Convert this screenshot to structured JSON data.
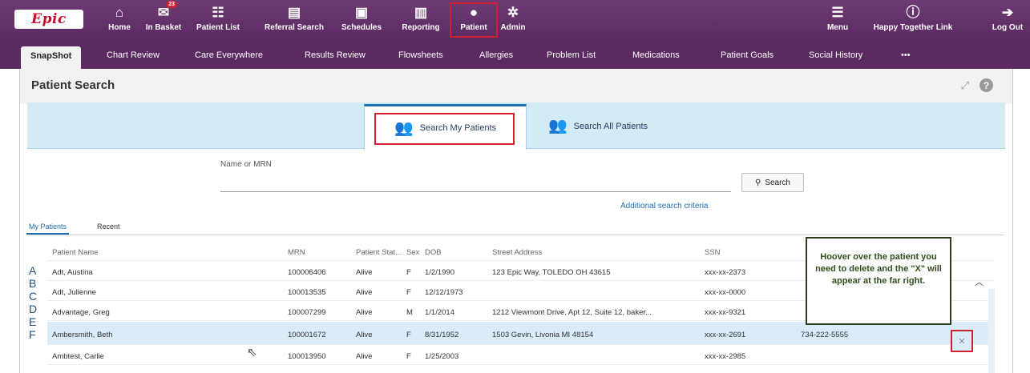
{
  "app": {
    "logo_text": "Epic",
    "brand_color": "#5b2a61",
    "highlight_color": "#d3202e"
  },
  "toolbar": {
    "buttons": [
      {
        "label": "Home",
        "icon": "home-icon"
      },
      {
        "label": "In Basket",
        "icon": "inbox-icon",
        "badge": "23"
      },
      {
        "label": "Patient List",
        "icon": "patient-list-icon"
      },
      {
        "label": "Referral Search",
        "icon": "referral-search-icon"
      },
      {
        "label": "Schedules",
        "icon": "calendar-icon"
      },
      {
        "label": "Reporting",
        "icon": "reporting-icon"
      },
      {
        "label": "Patient",
        "icon": "person-icon"
      },
      {
        "label": "Admin",
        "icon": "gear-icon"
      },
      {
        "label": "Menu",
        "icon": "menu-icon"
      },
      {
        "label": "Happy Together Link",
        "icon": "info-link-icon"
      },
      {
        "label": "Log Out",
        "icon": "logout-icon"
      }
    ]
  },
  "activity_tabs": [
    "SnapShot",
    "Chart Review",
    "Care Everywhere",
    "Results Review",
    "Flowsheets",
    "Allergies",
    "Problem List",
    "Medications",
    "Patient Goals",
    "Social History",
    "•••"
  ],
  "page": {
    "title": "Patient Search",
    "search_tabs": {
      "my_patients": "Search My Patients",
      "all_patients": "Search All Patients"
    },
    "search": {
      "label": "Name or MRN",
      "value": "",
      "button_label": "Search",
      "advanced_link": "Additional search criteria"
    },
    "list_tabs": {
      "my_patients": "My Patients",
      "recent": "Recent"
    },
    "alphabet": [
      "A",
      "B",
      "C",
      "D",
      "E",
      "F"
    ],
    "table": {
      "headers": {
        "name": "Patient Name",
        "mrn": "MRN",
        "status": "Patient Stat...",
        "sex": "Sex",
        "dob": "DOB",
        "address": "Street Address",
        "ssn": "SSN"
      },
      "rows": [
        {
          "name": "Adt, Austina",
          "mrn": "100006406",
          "status": "Alive",
          "sex": "F",
          "dob": "1/2/1990",
          "address": "123 Epic Way, TOLEDO OH 43615",
          "ssn": "xxx-xx-2373",
          "phone": ""
        },
        {
          "name": "Adt, Julienne",
          "mrn": "100013535",
          "status": "Alive",
          "sex": "F",
          "dob": "12/12/1973",
          "address": "",
          "ssn": "xxx-xx-0000",
          "phone": ""
        },
        {
          "name": "Advantage, Greg",
          "mrn": "100007299",
          "status": "Alive",
          "sex": "M",
          "dob": "1/1/2014",
          "address": "1212 Viewmont Drive, Apt 12, Suite 12, baker...",
          "ssn": "xxx-xx-9321",
          "phone": ""
        },
        {
          "name": "Ambersmith, Beth",
          "mrn": "100001672",
          "status": "Alive",
          "sex": "F",
          "dob": "8/31/1952",
          "address": "1503 Gevin, Livonia MI 48154",
          "ssn": "xxx-xx-2691",
          "phone": "734-222-5555"
        },
        {
          "name": "Ambtest, Carlie",
          "mrn": "100013950",
          "status": "Alive",
          "sex": "F",
          "dob": "1/25/2003",
          "address": "",
          "ssn": "xxx-xx-2985",
          "phone": ""
        }
      ],
      "hovered_row_index": 3
    },
    "callout_text": "Hoover over the patient you need to delete and the \"X\" will appear at the far right.",
    "remove_glyph": "×"
  }
}
